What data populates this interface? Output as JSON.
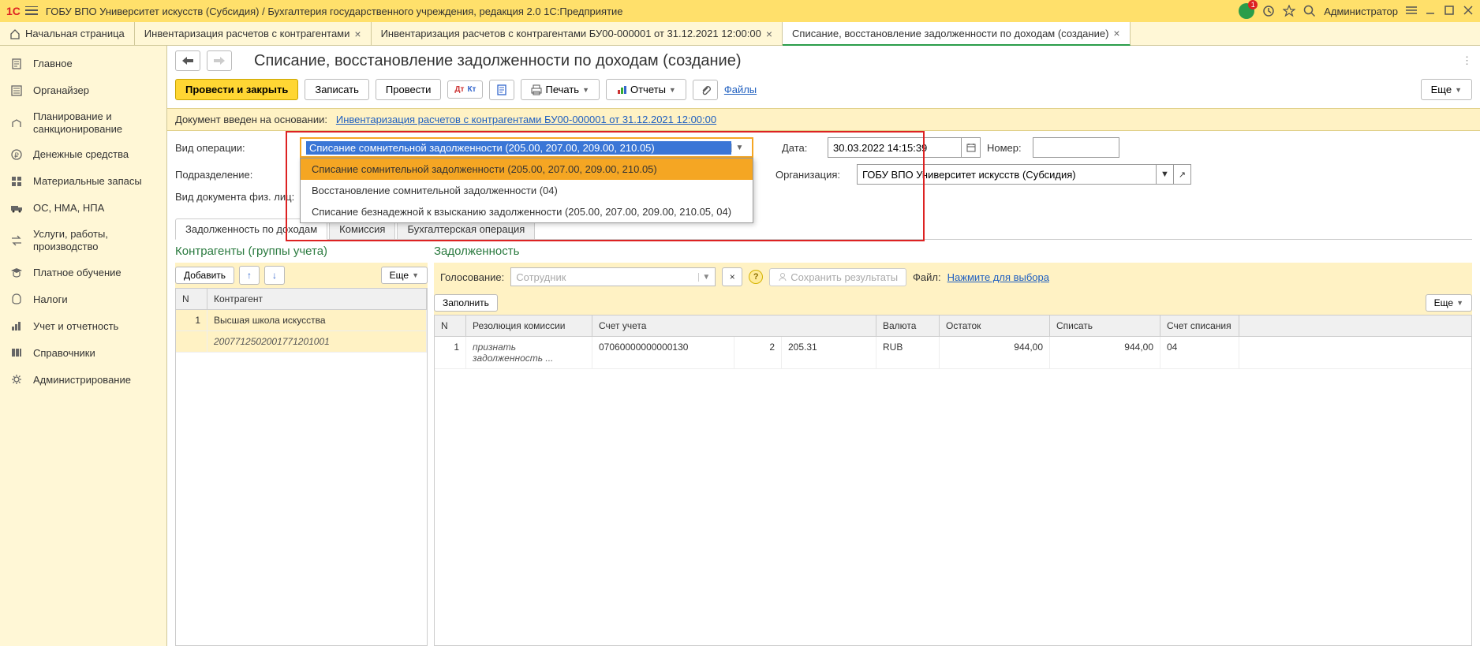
{
  "titlebar": {
    "app_title": "ГОБУ ВПО Университет искусств (Субсидия) / Бухгалтерия государственного учреждения, редакция 2.0 1С:Предприятие",
    "user": "Администратор",
    "badge_count": "1"
  },
  "tabs": {
    "home": "Начальная страница",
    "items": [
      {
        "label": "Инвентаризация расчетов с контрагентами",
        "active": false
      },
      {
        "label": "Инвентаризация расчетов с контрагентами БУ00-000001 от 31.12.2021 12:00:00",
        "active": false
      },
      {
        "label": "Списание, восстановление задолженности по доходам (создание)",
        "active": true
      }
    ]
  },
  "sidebar": {
    "items": [
      {
        "label": "Главное",
        "icon": "doc"
      },
      {
        "label": "Органайзер",
        "icon": "list"
      },
      {
        "label": "Планирование и санкционирование",
        "icon": "plan"
      },
      {
        "label": "Денежные средства",
        "icon": "ruble"
      },
      {
        "label": "Материальные запасы",
        "icon": "grid"
      },
      {
        "label": "ОС, НМА, НПА",
        "icon": "truck"
      },
      {
        "label": "Услуги, работы, производство",
        "icon": "swap"
      },
      {
        "label": "Платное обучение",
        "icon": "grad"
      },
      {
        "label": "Налоги",
        "icon": "emblem"
      },
      {
        "label": "Учет и отчетность",
        "icon": "chart"
      },
      {
        "label": "Справочники",
        "icon": "books"
      },
      {
        "label": "Администрирование",
        "icon": "gear"
      }
    ]
  },
  "page": {
    "title": "Списание, восстановление задолженности по доходам (создание)"
  },
  "toolbar": {
    "post_close": "Провести и закрыть",
    "save": "Записать",
    "post": "Провести",
    "print": "Печать",
    "reports": "Отчеты",
    "files": "Файлы",
    "more": "Еще"
  },
  "basis": {
    "label": "Документ введен на основании:",
    "link": "Инвентаризация расчетов с контрагентами БУ00-000001 от 31.12.2021 12:00:00"
  },
  "form": {
    "op_type_label": "Вид операции:",
    "op_type_value": "Списание сомнительной задолженности (205.00, 207.00, 209.00, 210.05)",
    "op_type_options": [
      "Списание сомнительной задолженности (205.00, 207.00, 209.00, 210.05)",
      "Восстановление сомнительной задолженности (04)",
      "Списание безнадежной к взысканию задолженности (205.00, 207.00, 209.00, 210.05, 04)"
    ],
    "dept_label": "Подразделение:",
    "phys_doc_label": "Вид документа физ. лиц:",
    "date_label": "Дата:",
    "date_value": "30.03.2022 14:15:39",
    "number_label": "Номер:",
    "org_label": "Организация:",
    "org_value": "ГОБУ ВПО Университет искусств (Субсидия)"
  },
  "doc_tabs": {
    "items": [
      "Задолженность по доходам",
      "Комиссия",
      "Бухгалтерская операция"
    ]
  },
  "counterparties": {
    "title": "Контрагенты (группы учета)",
    "add": "Добавить",
    "more": "Еще",
    "cols": {
      "n": "N",
      "name": "Контрагент"
    },
    "rows": [
      {
        "n": "1",
        "name": "Высшая школа искусства",
        "code": "2007712502001771201001"
      }
    ]
  },
  "debt": {
    "title": "Задолженность",
    "voting_label": "Голосование:",
    "voting_placeholder": "Сотрудник",
    "save_results": "Сохранить результаты",
    "file_label": "Файл:",
    "file_link": "Нажмите для выбора",
    "fill": "Заполнить",
    "more": "Еще",
    "cols": {
      "n": "N",
      "res": "Резолюция комиссии",
      "acc": "Счет учета",
      "cur": "Валюта",
      "bal": "Остаток",
      "writeoff": "Списать",
      "acc2": "Счет списания"
    },
    "rows": [
      {
        "n": "1",
        "res": "признать задолженность ...",
        "acc_code": "07060000000000130",
        "acc_n": "2",
        "acc_sub": "205.31",
        "cur": "RUB",
        "bal": "944,00",
        "writeoff": "944,00",
        "acc2": "04"
      }
    ]
  }
}
